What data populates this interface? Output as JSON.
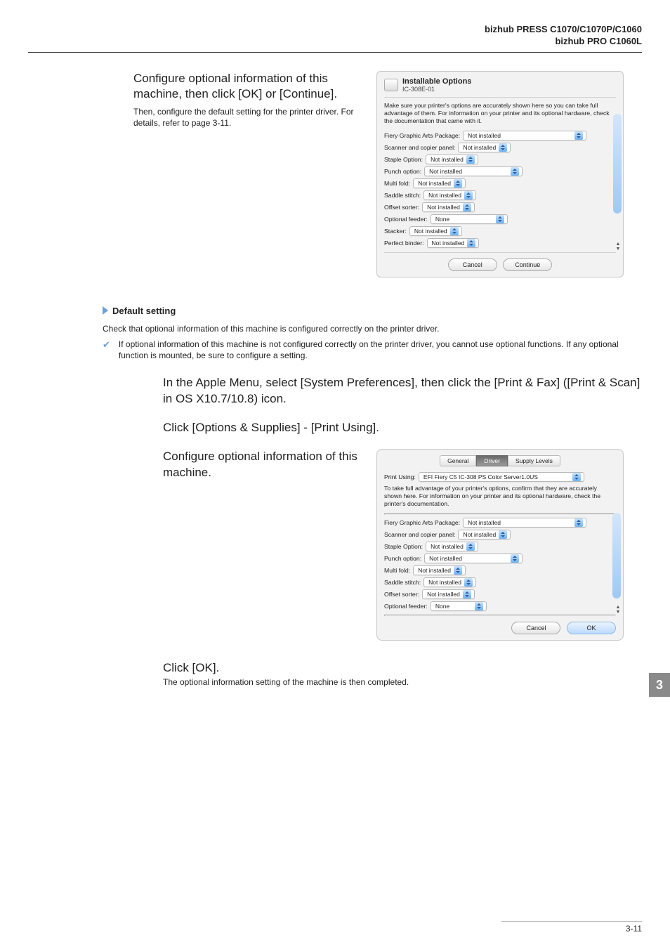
{
  "header": {
    "line1": "bizhub PRESS C1070/C1070P/C1060",
    "line2": "bizhub PRO C1060L"
  },
  "configure_section": {
    "heading": "Configure optional information of this machine, then click [OK] or [Continue].",
    "subtext": "Then, configure the default setting for the printer driver. For details, refer to page 3-11."
  },
  "dialog1": {
    "title": "Installable Options",
    "subtitle": "IC-308E-01",
    "desc": "Make sure your printer's options are accurately shown here so you can take full advantage of them. For information on your printer and its optional hardware, check the documentation that came with it.",
    "options": {
      "fiery": {
        "label": "Fiery Graphic Arts Package:",
        "value": "Not installed"
      },
      "scanner": {
        "label": "Scanner and copier panel:",
        "value": "Not installed"
      },
      "staple": {
        "label": "Staple Option:",
        "value": "Not installed"
      },
      "punch": {
        "label": "Punch option:",
        "value": "Not installed"
      },
      "multifold": {
        "label": "Multi fold:",
        "value": "Not installed"
      },
      "saddle": {
        "label": "Saddle stitch:",
        "value": "Not installed"
      },
      "offset": {
        "label": "Offset sorter:",
        "value": "Not installed"
      },
      "feeder": {
        "label": "Optional feeder:",
        "value": "None"
      },
      "stacker": {
        "label": "Stacker:",
        "value": "Not installed"
      },
      "binder": {
        "label": "Perfect binder:",
        "value": "Not installed"
      }
    },
    "buttons": {
      "cancel": "Cancel",
      "continue": "Continue"
    }
  },
  "default_setting": {
    "heading": "Default setting",
    "para1": "Check that optional information of this machine is configured correctly on the printer driver.",
    "check": "If optional information of this machine is not configured correctly on the printer driver, you cannot use optional functions. If any optional function is mounted, be sure to configure a setting.",
    "step1": "In the Apple Menu, select [System Preferences], then click the [Print & Fax] ([Print & Scan] in OS X10.7/10.8) icon.",
    "step2": "Click [Options & Supplies] - [Print Using].",
    "step3": "Configure optional information of this machine."
  },
  "dialog2": {
    "tabs": {
      "general": "General",
      "driver": "Driver",
      "supply": "Supply Levels"
    },
    "print_using_label": "Print Using:",
    "print_using_value": "EFI Fiery C5 IC-308 PS Color Server1.0US",
    "desc": "To take full advantage of your printer's options, confirm that they are accurately shown here. For information on your printer and its optional hardware, check the printer's documentation.",
    "options": {
      "fiery": {
        "label": "Fiery Graphic Arts Package:",
        "value": "Not installed"
      },
      "scanner": {
        "label": "Scanner and copier panel:",
        "value": "Not installed"
      },
      "staple": {
        "label": "Staple Option:",
        "value": "Not installed"
      },
      "punch": {
        "label": "Punch option:",
        "value": "Not installed"
      },
      "multifold": {
        "label": "Multi fold:",
        "value": "Not installed"
      },
      "saddle": {
        "label": "Saddle stitch:",
        "value": "Not installed"
      },
      "offset": {
        "label": "Offset sorter:",
        "value": "Not installed"
      },
      "feeder": {
        "label": "Optional feeder:",
        "value": "None"
      }
    },
    "buttons": {
      "cancel": "Cancel",
      "ok": "OK"
    }
  },
  "last": {
    "step4": "Click [OK].",
    "step4_sub": "The optional information setting of the machine is then completed."
  },
  "page_number": "3-11",
  "chapter_badge": "3"
}
